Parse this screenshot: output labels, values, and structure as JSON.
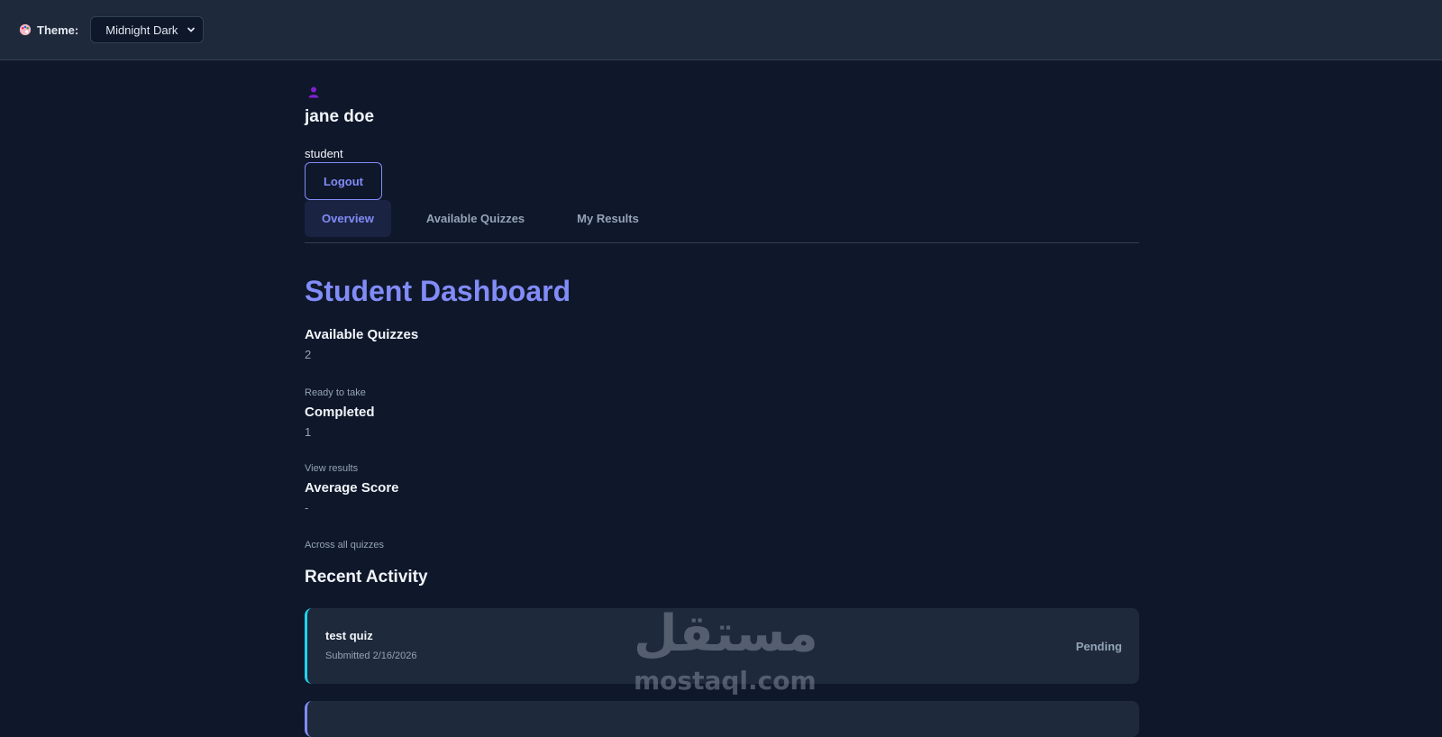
{
  "topbar": {
    "theme_label": "Theme:",
    "theme_icon": "palette-icon",
    "theme_select": {
      "selected": "Midnight Dark"
    }
  },
  "user": {
    "avatar_icon": "user-icon",
    "name": "jane doe",
    "role": "student",
    "logout_label": "Logout"
  },
  "tabs": [
    {
      "label": "Overview",
      "active": true
    },
    {
      "label": "Available Quizzes",
      "active": false
    },
    {
      "label": "My Results",
      "active": false
    }
  ],
  "page_title": "Student Dashboard",
  "stats": [
    {
      "label": "Available Quizzes",
      "value": "2",
      "description": "Ready to take"
    },
    {
      "label": "Completed",
      "value": "1",
      "description": "View results"
    },
    {
      "label": "Average Score",
      "value": "-",
      "description": "Across all quizzes"
    }
  ],
  "recent_activity": {
    "title": "Recent Activity",
    "items": [
      {
        "title": "test quiz",
        "subtitle": "Submitted 2/16/2026",
        "status": "Pending"
      }
    ]
  },
  "watermark": {
    "arabic": "مستقل",
    "latin": "mostaql.com"
  },
  "colors": {
    "background": "#0f172a",
    "surface": "#1e293b",
    "accent": "#818cf8",
    "activity_border": "#22d3ee",
    "muted_text": "#94a3b8"
  }
}
